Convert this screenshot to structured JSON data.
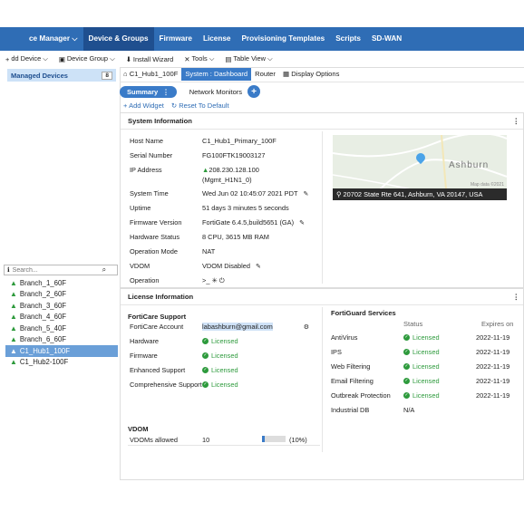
{
  "topnav": {
    "items": [
      "ce Manager ⌵",
      "Device & Groups",
      "Firmware",
      "License",
      "Provisioning Templates",
      "Scripts",
      "SD-WAN"
    ],
    "active_index": 1
  },
  "toolbar": {
    "add_device": "dd Device ⌵",
    "device_group": "Device Group ⌵",
    "install_wizard": "Install Wizard",
    "tools": "Tools ⌵",
    "table_view": "Table View ⌵"
  },
  "sidebar": {
    "header": "Managed Devices",
    "count": "8",
    "search_placeholder": "Search...",
    "devices": [
      "Branch_1_60F",
      "Branch_2_60F",
      "Branch_3_60F",
      "Branch_4_60F",
      "Branch_5_40F",
      "Branch_6_60F",
      "C1_Hub1_100F",
      "C1_Hub2-100F"
    ],
    "selected_index": 6
  },
  "tabs": {
    "device": "C1_Hub1_100F",
    "dashboard": "System : Dashboard",
    "router": "Router",
    "display_options": "Display Options"
  },
  "subtabs": {
    "summary": "Summary",
    "network_monitors": "Network Monitors"
  },
  "actions": {
    "add_widget": "Add Widget",
    "reset": "Reset To Default"
  },
  "system_info": {
    "title": "System Information",
    "rows": [
      {
        "k": "Host Name",
        "v": "C1_Hub1_Primary_100F"
      },
      {
        "k": "Serial Number",
        "v": "FG100FTK19003127"
      },
      {
        "k": "IP Address",
        "v": "208.230.128.100"
      },
      {
        "k": "",
        "v": "(Mgmt_H1N1_0)"
      },
      {
        "k": "System Time",
        "v": "Wed Jun 02 10:45:07 2021 PDT"
      },
      {
        "k": "Uptime",
        "v": "51 days 3 minutes 5 seconds"
      },
      {
        "k": "Firmware Version",
        "v": "FortiGate 6.4.5,build5651 (GA)"
      },
      {
        "k": "Hardware Status",
        "v": "8 CPU, 3615 MB RAM"
      },
      {
        "k": "Operation Mode",
        "v": "NAT"
      },
      {
        "k": "VDOM",
        "v": "VDOM Disabled"
      },
      {
        "k": "Operation",
        "v": ">_  ✳  ⏻"
      }
    ],
    "map_address": "20702 State Rte 641, Ashburn, VA 20147, USA",
    "map_town": "Ashburn",
    "map_credit": "Map data ©2021"
  },
  "license_info": {
    "title": "License Information",
    "forticare_title": "FortiCare Support",
    "forticare_rows": [
      {
        "k": "FortiCare Account",
        "v": "labashburn@gmail.com"
      },
      {
        "k": "Hardware",
        "v": "Licensed"
      },
      {
        "k": "Firmware",
        "v": "Licensed"
      },
      {
        "k": "Enhanced Support",
        "v": "Licensed"
      },
      {
        "k": "Comprehensive Support",
        "v": "Licensed"
      }
    ],
    "vdom_title": "VDOM",
    "vdom_label": "VDOMs allowed",
    "vdom_value": "10",
    "vdom_pct": "(10%)",
    "vdom_fraction": 0.1,
    "fortiguard_title": "FortiGuard Services",
    "col_status": "Status",
    "col_expires": "Expires on",
    "services": [
      {
        "name": "AntiVirus",
        "status": "Licensed",
        "expires": "2022-11-19"
      },
      {
        "name": "IPS",
        "status": "Licensed",
        "expires": "2022-11-19"
      },
      {
        "name": "Web Filtering",
        "status": "Licensed",
        "expires": "2022-11-19"
      },
      {
        "name": "Email Filtering",
        "status": "Licensed",
        "expires": "2022-11-19"
      },
      {
        "name": "Outbreak Protection",
        "status": "Licensed",
        "expires": "2022-11-19"
      },
      {
        "name": "Industrial DB",
        "status": "N/A",
        "expires": ""
      }
    ]
  },
  "colors": {
    "brand": "#2f6db5",
    "licensed": "#2d9a3c",
    "selected": "#6a9fd8"
  }
}
